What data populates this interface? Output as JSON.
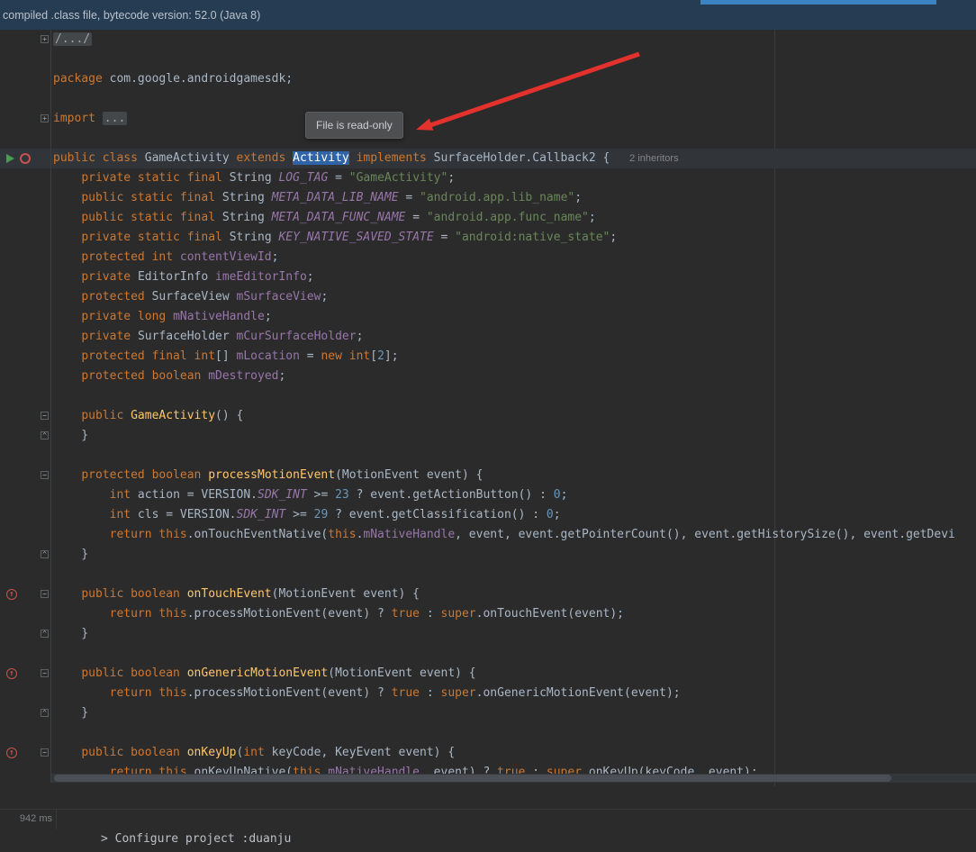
{
  "banner": {
    "text": "compiled .class file, bytecode version: 52.0 (Java 8)"
  },
  "tooltip": {
    "text": "File is read-only"
  },
  "status": {
    "build_time": "942 ms"
  },
  "console": {
    "line": "> Configure project :duanju"
  },
  "colors": {
    "editor_bg": "#2b2b2b",
    "banner_bg": "#263c52",
    "progress_blue": "#3c83c4",
    "selection_blue": "#2f65a8",
    "arrow_red": "#e3312d",
    "keyword_orange": "#cc7832",
    "string_green": "#6a8759",
    "field_purple": "#9876aa",
    "method_yellow": "#ffc66b"
  },
  "icons": {
    "run": "run-icon",
    "marker": "class-marker-icon",
    "override": "override-method-icon"
  },
  "editor": {
    "inlay_hint": "2 inheritors",
    "lines": [
      {
        "fold": "folded",
        "tokens": [
          [
            "fold",
            "/.../"
          ]
        ]
      },
      {
        "tokens": []
      },
      {
        "tokens": [
          [
            "kw",
            "package "
          ],
          [
            "def",
            "com.google.androidgamesdk;"
          ]
        ]
      },
      {
        "tokens": []
      },
      {
        "fold": "folded",
        "tokens": [
          [
            "kw",
            "import "
          ],
          [
            "fold",
            "..."
          ]
        ]
      },
      {
        "tokens": []
      },
      {
        "current": true,
        "icons": [
          "run",
          "marker"
        ],
        "tokens": [
          [
            "kw",
            "public class "
          ],
          [
            "def",
            "GameActivity "
          ],
          [
            "kw",
            "extends "
          ],
          [
            "hl",
            "Activity"
          ],
          [
            "def",
            " "
          ],
          [
            "kw",
            "implements "
          ],
          [
            "def",
            "SurfaceHolder.Callback2 { "
          ],
          [
            "inlay",
            "2 inheritors"
          ]
        ]
      },
      {
        "tokens": [
          [
            "def",
            "    "
          ],
          [
            "kw",
            "private static final "
          ],
          [
            "def",
            "String "
          ],
          [
            "sfld",
            "LOG_TAG"
          ],
          [
            "def",
            " = "
          ],
          [
            "str",
            "\"GameActivity\""
          ],
          [
            "def",
            ";"
          ]
        ]
      },
      {
        "tokens": [
          [
            "def",
            "    "
          ],
          [
            "kw",
            "public static final "
          ],
          [
            "def",
            "String "
          ],
          [
            "sfld",
            "META_DATA_LIB_NAME"
          ],
          [
            "def",
            " = "
          ],
          [
            "str",
            "\"android.app.lib_name\""
          ],
          [
            "def",
            ";"
          ]
        ]
      },
      {
        "tokens": [
          [
            "def",
            "    "
          ],
          [
            "kw",
            "public static final "
          ],
          [
            "def",
            "String "
          ],
          [
            "sfld",
            "META_DATA_FUNC_NAME"
          ],
          [
            "def",
            " = "
          ],
          [
            "str",
            "\"android.app.func_name\""
          ],
          [
            "def",
            ";"
          ]
        ]
      },
      {
        "tokens": [
          [
            "def",
            "    "
          ],
          [
            "kw",
            "private static final "
          ],
          [
            "def",
            "String "
          ],
          [
            "sfld",
            "KEY_NATIVE_SAVED_STATE"
          ],
          [
            "def",
            " = "
          ],
          [
            "str",
            "\"android:native_state\""
          ],
          [
            "def",
            ";"
          ]
        ]
      },
      {
        "tokens": [
          [
            "def",
            "    "
          ],
          [
            "kw",
            "protected int "
          ],
          [
            "fld",
            "contentViewId"
          ],
          [
            "def",
            ";"
          ]
        ]
      },
      {
        "tokens": [
          [
            "def",
            "    "
          ],
          [
            "kw",
            "private "
          ],
          [
            "def",
            "EditorInfo "
          ],
          [
            "fld",
            "imeEditorInfo"
          ],
          [
            "def",
            ";"
          ]
        ]
      },
      {
        "tokens": [
          [
            "def",
            "    "
          ],
          [
            "kw",
            "protected "
          ],
          [
            "def",
            "SurfaceView "
          ],
          [
            "fld",
            "mSurfaceView"
          ],
          [
            "def",
            ";"
          ]
        ]
      },
      {
        "tokens": [
          [
            "def",
            "    "
          ],
          [
            "kw",
            "private long "
          ],
          [
            "fld",
            "mNativeHandle"
          ],
          [
            "def",
            ";"
          ]
        ]
      },
      {
        "tokens": [
          [
            "def",
            "    "
          ],
          [
            "kw",
            "private "
          ],
          [
            "def",
            "SurfaceHolder "
          ],
          [
            "fld",
            "mCurSurfaceHolder"
          ],
          [
            "def",
            ";"
          ]
        ]
      },
      {
        "tokens": [
          [
            "def",
            "    "
          ],
          [
            "kw",
            "protected final int"
          ],
          [
            "def",
            "[] "
          ],
          [
            "fld",
            "mLocation"
          ],
          [
            "def",
            " = "
          ],
          [
            "kw",
            "new int"
          ],
          [
            "def",
            "["
          ],
          [
            "num",
            "2"
          ],
          [
            "def",
            "];"
          ]
        ]
      },
      {
        "tokens": [
          [
            "def",
            "    "
          ],
          [
            "kw",
            "protected boolean "
          ],
          [
            "fld",
            "mDestroyed"
          ],
          [
            "def",
            ";"
          ]
        ]
      },
      {
        "tokens": []
      },
      {
        "fold": "start",
        "tokens": [
          [
            "def",
            "    "
          ],
          [
            "kw",
            "public "
          ],
          [
            "mth",
            "GameActivity"
          ],
          [
            "def",
            "() {"
          ]
        ]
      },
      {
        "fold": "end",
        "tokens": [
          [
            "def",
            "    }"
          ]
        ]
      },
      {
        "tokens": []
      },
      {
        "fold": "start",
        "tokens": [
          [
            "def",
            "    "
          ],
          [
            "kw",
            "protected boolean "
          ],
          [
            "mth",
            "processMotionEvent"
          ],
          [
            "def",
            "(MotionEvent event) {"
          ]
        ]
      },
      {
        "tokens": [
          [
            "def",
            "        "
          ],
          [
            "kw",
            "int"
          ],
          [
            "def",
            " action = VERSION."
          ],
          [
            "sfld",
            "SDK_INT"
          ],
          [
            "def",
            " >= "
          ],
          [
            "num",
            "23"
          ],
          [
            "def",
            " ? event.getActionButton() : "
          ],
          [
            "num",
            "0"
          ],
          [
            "def",
            ";"
          ]
        ]
      },
      {
        "tokens": [
          [
            "def",
            "        "
          ],
          [
            "kw",
            "int"
          ],
          [
            "def",
            " cls = VERSION."
          ],
          [
            "sfld",
            "SDK_INT"
          ],
          [
            "def",
            " >= "
          ],
          [
            "num",
            "29"
          ],
          [
            "def",
            " ? event.getClassification() : "
          ],
          [
            "num",
            "0"
          ],
          [
            "def",
            ";"
          ]
        ]
      },
      {
        "tokens": [
          [
            "def",
            "        "
          ],
          [
            "kw",
            "return this"
          ],
          [
            "def",
            ".onTouchEventNative("
          ],
          [
            "kw",
            "this"
          ],
          [
            "def",
            "."
          ],
          [
            "fld",
            "mNativeHandle"
          ],
          [
            "def",
            ", event, event.getPointerCount(), event.getHistorySize(), event.getDevi"
          ]
        ]
      },
      {
        "fold": "end",
        "tokens": [
          [
            "def",
            "    }"
          ]
        ]
      },
      {
        "tokens": []
      },
      {
        "fold": "start",
        "icons": [
          "override"
        ],
        "tokens": [
          [
            "def",
            "    "
          ],
          [
            "kw",
            "public boolean "
          ],
          [
            "mth",
            "onTouchEvent"
          ],
          [
            "def",
            "(MotionEvent event) {"
          ]
        ]
      },
      {
        "tokens": [
          [
            "def",
            "        "
          ],
          [
            "kw",
            "return this"
          ],
          [
            "def",
            ".processMotionEvent(event) ? "
          ],
          [
            "kw",
            "true"
          ],
          [
            "def",
            " : "
          ],
          [
            "kw",
            "super"
          ],
          [
            "def",
            ".onTouchEvent(event);"
          ]
        ]
      },
      {
        "fold": "end",
        "tokens": [
          [
            "def",
            "    }"
          ]
        ]
      },
      {
        "tokens": []
      },
      {
        "fold": "start",
        "icons": [
          "override"
        ],
        "tokens": [
          [
            "def",
            "    "
          ],
          [
            "kw",
            "public boolean "
          ],
          [
            "mth",
            "onGenericMotionEvent"
          ],
          [
            "def",
            "(MotionEvent event) {"
          ]
        ]
      },
      {
        "tokens": [
          [
            "def",
            "        "
          ],
          [
            "kw",
            "return this"
          ],
          [
            "def",
            ".processMotionEvent(event) ? "
          ],
          [
            "kw",
            "true"
          ],
          [
            "def",
            " : "
          ],
          [
            "kw",
            "super"
          ],
          [
            "def",
            ".onGenericMotionEvent(event);"
          ]
        ]
      },
      {
        "fold": "end",
        "tokens": [
          [
            "def",
            "    }"
          ]
        ]
      },
      {
        "tokens": []
      },
      {
        "fold": "start",
        "icons": [
          "override"
        ],
        "tokens": [
          [
            "def",
            "    "
          ],
          [
            "kw",
            "public boolean "
          ],
          [
            "mth",
            "onKeyUp"
          ],
          [
            "def",
            "("
          ],
          [
            "kw",
            "int"
          ],
          [
            "def",
            " keyCode, KeyEvent event) {"
          ]
        ]
      },
      {
        "tokens": [
          [
            "def",
            "        "
          ],
          [
            "kw",
            "return this"
          ],
          [
            "def",
            ".onKeyUpNative("
          ],
          [
            "kw",
            "this"
          ],
          [
            "def",
            "."
          ],
          [
            "fld",
            "mNativeHandle"
          ],
          [
            "def",
            ", event) ? "
          ],
          [
            "kw",
            "true"
          ],
          [
            "def",
            " : "
          ],
          [
            "kw",
            "super"
          ],
          [
            "def",
            ".onKeyUp(keyCode, event);"
          ]
        ]
      }
    ]
  }
}
